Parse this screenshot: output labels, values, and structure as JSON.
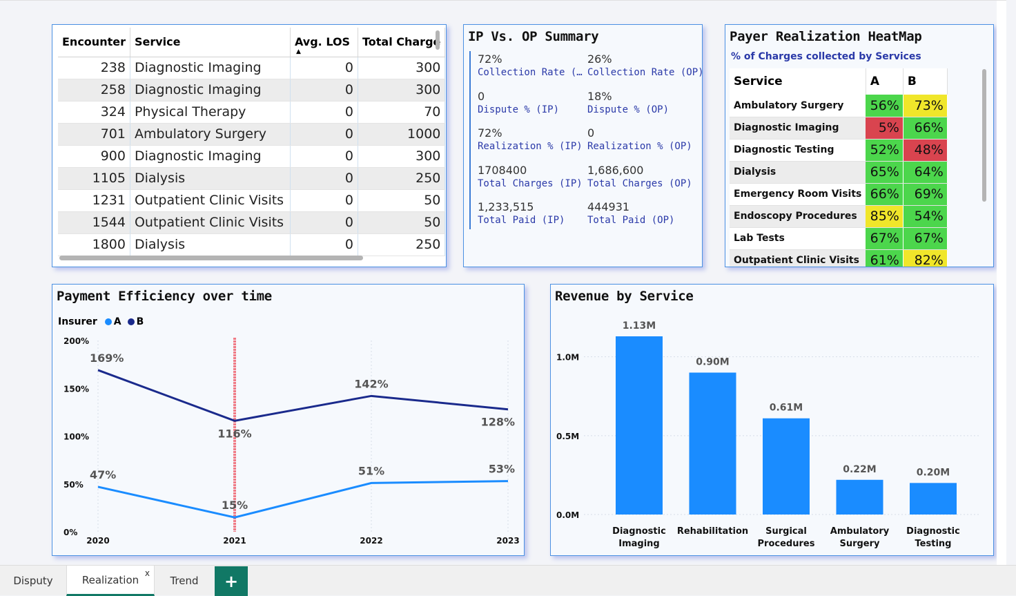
{
  "encounters_table": {
    "headers": [
      "Encounter",
      "Service",
      "Avg. LOS",
      "Total Charge"
    ],
    "rows": [
      [
        "238",
        "Diagnostic Imaging",
        "0",
        "300"
      ],
      [
        "258",
        "Diagnostic Imaging",
        "0",
        "300"
      ],
      [
        "324",
        "Physical Therapy",
        "0",
        "70"
      ],
      [
        "701",
        "Ambulatory Surgery",
        "0",
        "1000"
      ],
      [
        "900",
        "Diagnostic Imaging",
        "0",
        "300"
      ],
      [
        "1105",
        "Dialysis",
        "0",
        "250"
      ],
      [
        "1231",
        "Outpatient Clinic Visits",
        "0",
        "50"
      ],
      [
        "1544",
        "Outpatient Clinic Visits",
        "0",
        "50"
      ],
      [
        "1800",
        "Dialysis",
        "0",
        "250"
      ]
    ]
  },
  "ipop": {
    "title": "IP Vs. OP Summary",
    "kpis": [
      {
        "value": "72%",
        "label": "Collection Rate (…"
      },
      {
        "value": "26%",
        "label": "Collection Rate (OP)"
      },
      {
        "value": "0",
        "label": "Dispute % (IP)"
      },
      {
        "value": "18%",
        "label": "Dispute % (OP)"
      },
      {
        "value": "72%",
        "label": "Realization % (IP)"
      },
      {
        "value": "0",
        "label": "Realization % (OP)"
      },
      {
        "value": "1708400",
        "label": "Total Charges (IP)"
      },
      {
        "value": "1,686,600",
        "label": "Total Charges (OP)"
      },
      {
        "value": "1,233,515",
        "label": "Total Paid (IP)"
      },
      {
        "value": "444931",
        "label": "Total Paid (OP)"
      }
    ]
  },
  "heatmap": {
    "title": "Payer Realization HeatMap",
    "subtitle": "% of Charges collected by Services",
    "headers": [
      "Service",
      "A",
      "B"
    ],
    "rows": [
      {
        "service": "Ambulatory Surgery",
        "a": "56%",
        "a_color": "#4cd64c",
        "b": "73%",
        "b_color": "#f0e62a"
      },
      {
        "service": "Diagnostic Imaging",
        "a": "5%",
        "a_color": "#d9444f",
        "b": "66%",
        "b_color": "#4cd64c"
      },
      {
        "service": "Diagnostic Testing",
        "a": "52%",
        "a_color": "#4cd64c",
        "b": "48%",
        "b_color": "#d9444f"
      },
      {
        "service": "Dialysis",
        "a": "65%",
        "a_color": "#4cd64c",
        "b": "64%",
        "b_color": "#4cd64c"
      },
      {
        "service": "Emergency Room Visits",
        "a": "66%",
        "a_color": "#4cd64c",
        "b": "69%",
        "b_color": "#4cd64c"
      },
      {
        "service": "Endoscopy Procedures",
        "a": "85%",
        "a_color": "#f0e62a",
        "b": "54%",
        "b_color": "#4cd64c"
      },
      {
        "service": "Lab Tests",
        "a": "67%",
        "a_color": "#4cd64c",
        "b": "67%",
        "b_color": "#4cd64c"
      },
      {
        "service": "Outpatient Clinic Visits",
        "a": "61%",
        "a_color": "#4cd64c",
        "b": "82%",
        "b_color": "#f0e62a"
      }
    ]
  },
  "chart_data": [
    {
      "type": "line",
      "title": "Payment Efficiency over time",
      "legend_title": "Insurer",
      "x": [
        "2020",
        "2021",
        "2022",
        "2023"
      ],
      "ylim": [
        0,
        200
      ],
      "yticks": [
        "0%",
        "50%",
        "100%",
        "150%",
        "200%"
      ],
      "series": [
        {
          "name": "A",
          "color": "#1a8cff",
          "values": [
            47,
            15,
            51,
            53
          ],
          "labels": [
            "47%",
            "15%",
            "51%",
            "53%"
          ]
        },
        {
          "name": "B",
          "color": "#1a2a8c",
          "values": [
            169,
            116,
            142,
            128
          ],
          "labels": [
            "169%",
            "116%",
            "142%",
            "128%"
          ]
        }
      ],
      "marker_x": "2021",
      "grid": true
    },
    {
      "type": "bar",
      "title": "Revenue by Service",
      "categories": [
        "Diagnostic Imaging",
        "Rehabilitation",
        "Surgical Procedures",
        "Ambulatory Surgery",
        "Diagnostic Testing"
      ],
      "values": [
        1.13,
        0.9,
        0.61,
        0.22,
        0.2
      ],
      "labels": [
        "1.13M",
        "0.90M",
        "0.61M",
        "0.22M",
        "0.20M"
      ],
      "ylim": [
        0,
        1.13
      ],
      "yticks": [
        "0.0M",
        "0.5M",
        "1.0M"
      ],
      "color": "#1a8cff",
      "grid": true
    }
  ],
  "tabs": [
    {
      "label": "Disputy"
    },
    {
      "label": "Realization",
      "active": true,
      "close": "x"
    },
    {
      "label": "Trend"
    }
  ],
  "add_tab_label": "+"
}
